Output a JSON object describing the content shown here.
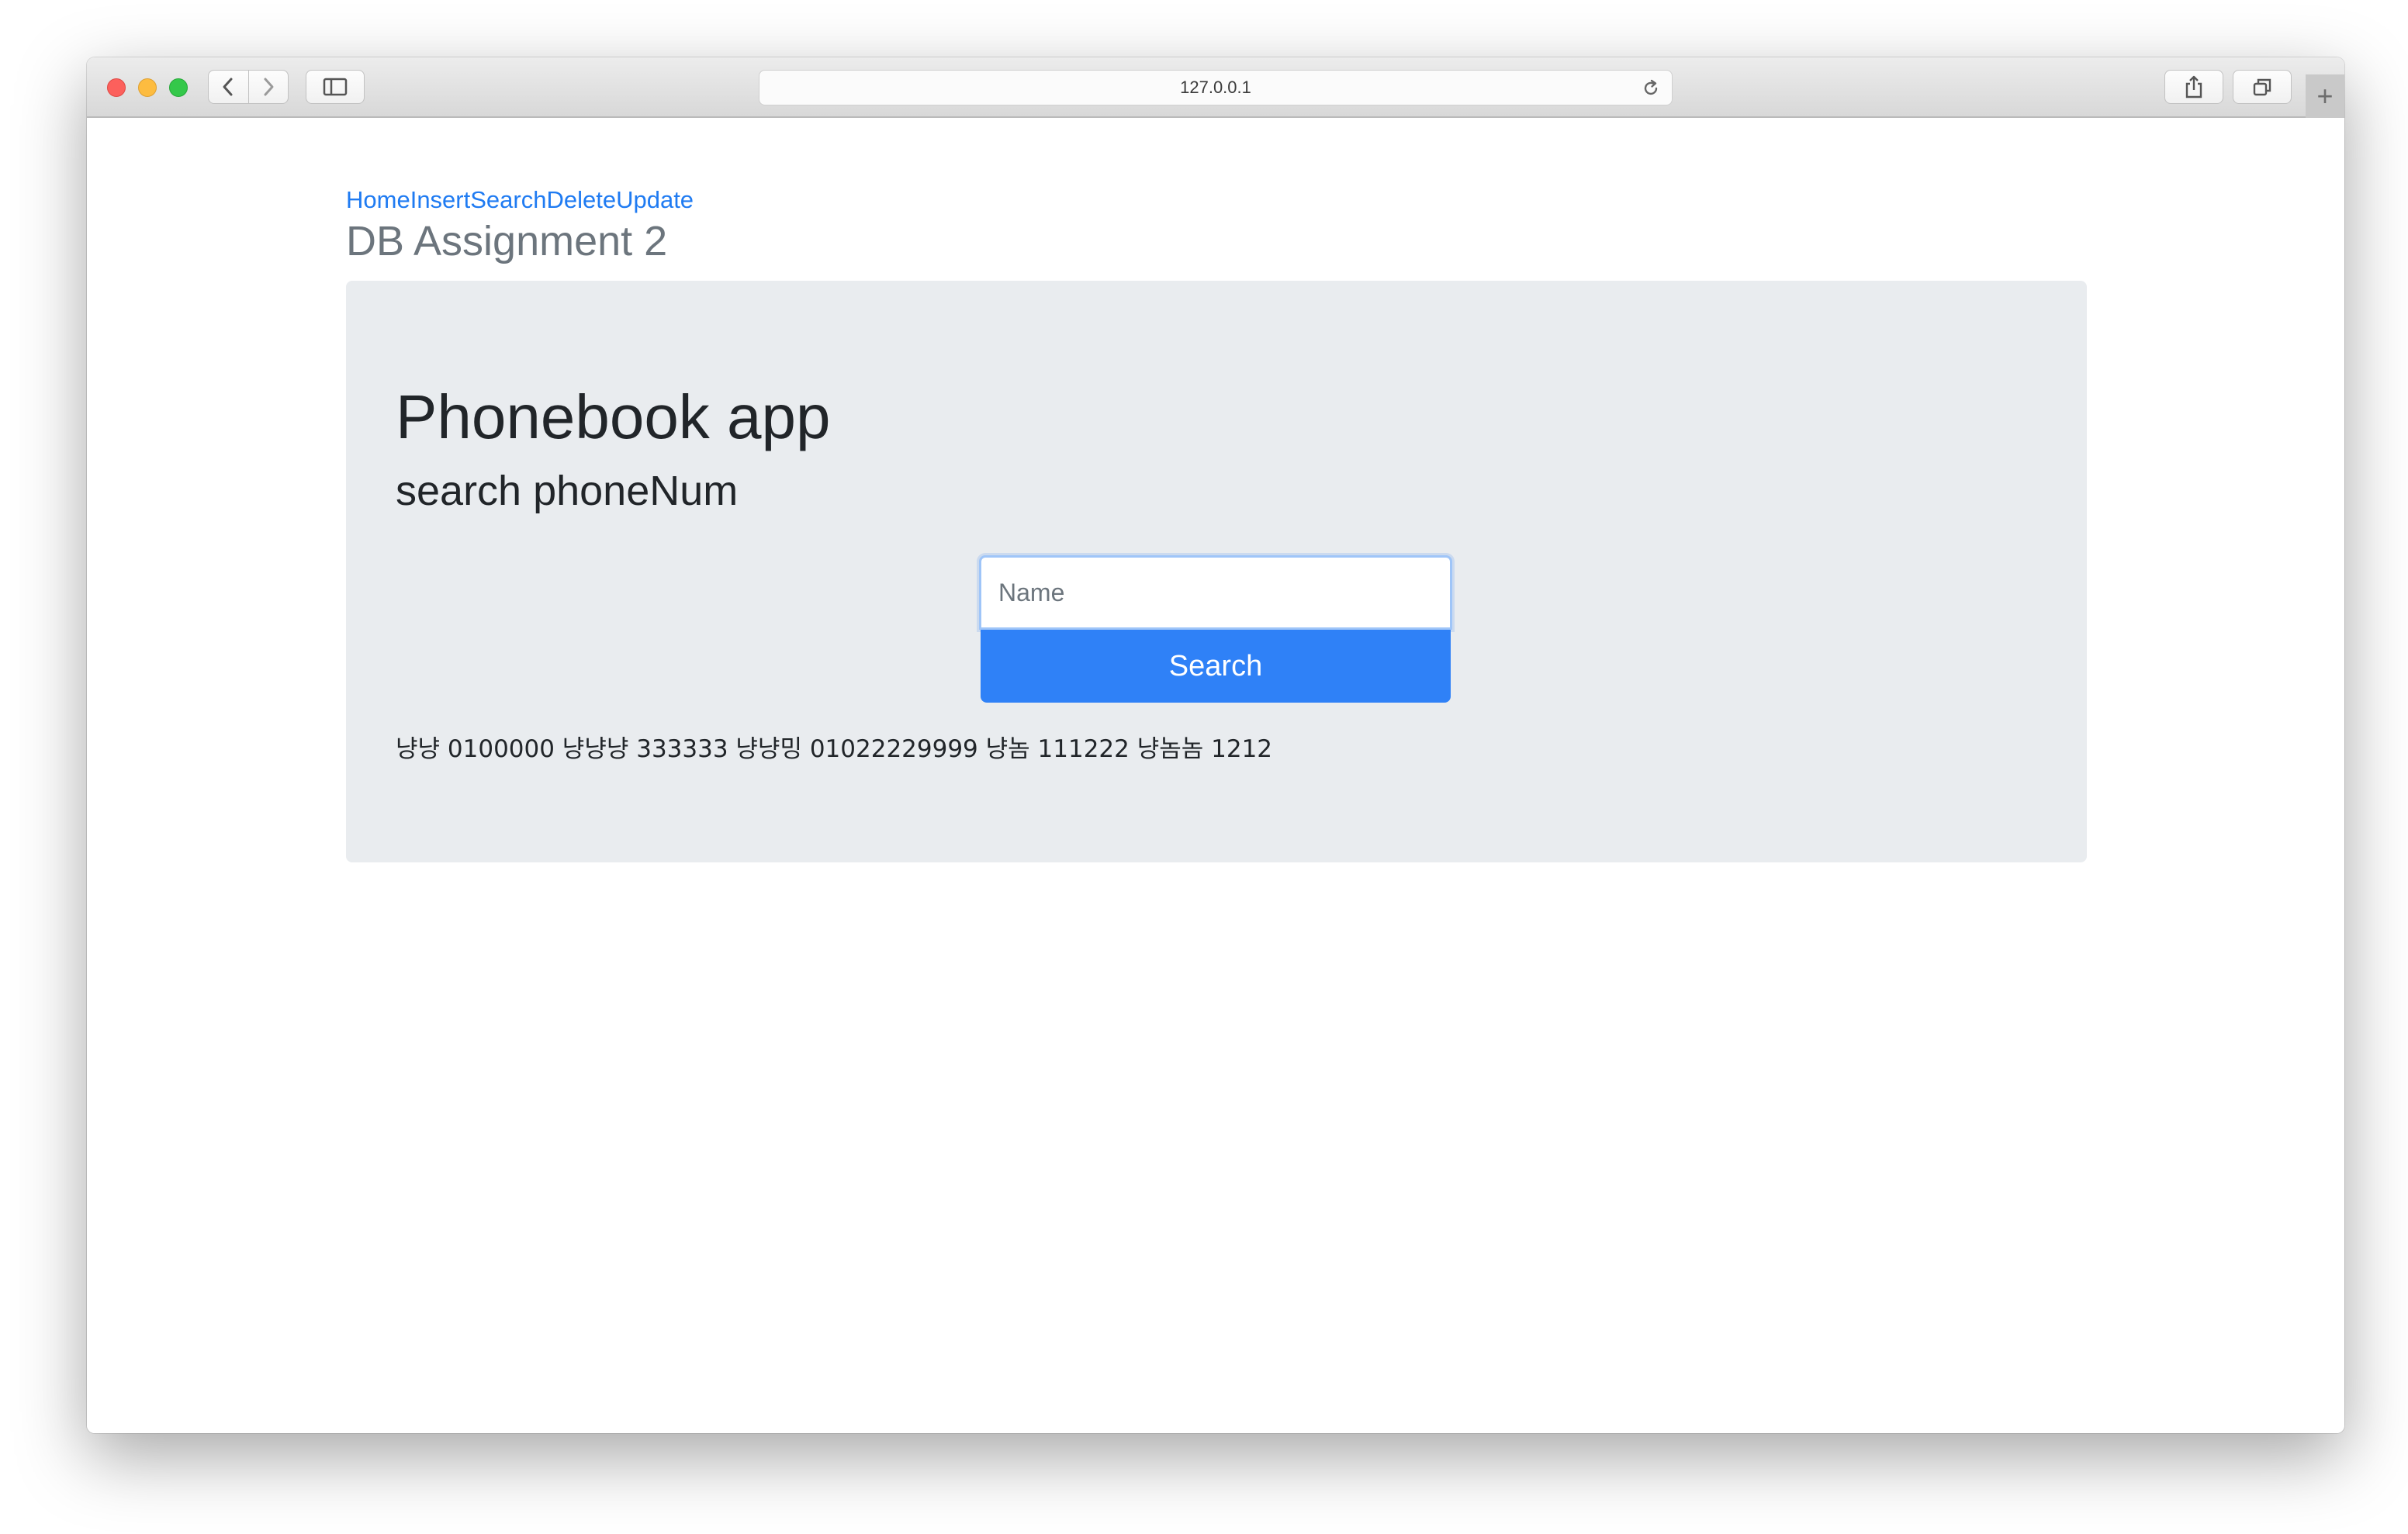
{
  "browser": {
    "url": "127.0.0.1"
  },
  "nav": {
    "links": [
      "Home",
      "Insert",
      "Search",
      "Delete",
      "Update"
    ]
  },
  "brand": "DB Assignment 2",
  "main": {
    "title": "Phonebook app",
    "subtitle": "search phoneNum",
    "name_placeholder": "Name",
    "name_value": "",
    "search_label": "Search",
    "results_text": "냥냥 0100000 냥냥냥 333333 냥냥밍 01022229999 냥놈 111222 냥놈놈 1212"
  },
  "colors": {
    "link": "#1f7bf2",
    "button": "#2f81f7",
    "jumbotron": "#e9ecef",
    "brand_text": "#6c757d"
  },
  "icons": {
    "back": "chevron-left-icon",
    "forward": "chevron-right-icon",
    "sidebar": "sidebar-icon",
    "reload": "reload-icon",
    "share": "share-icon",
    "tabs": "tabs-icon",
    "new_tab": "plus-icon"
  }
}
